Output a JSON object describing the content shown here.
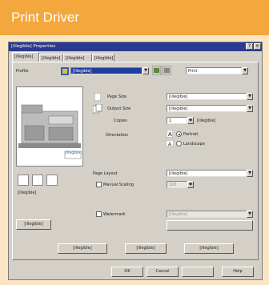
{
  "slide": {
    "title": "Print Driver"
  },
  "window": {
    "title": "[illegible] Properties",
    "buttons": {
      "help": "?",
      "close": "×"
    }
  },
  "tabs": [
    {
      "label": "[illegible]"
    },
    {
      "label": "[illegible]"
    },
    {
      "label": "[illegible]"
    },
    {
      "label": "[illegible]"
    }
  ],
  "profile": {
    "label": "Profile",
    "value": "[illegible]",
    "output_value": "Print"
  },
  "settings": {
    "page_size_label": "Page Size",
    "page_size_value": "[illegible]",
    "output_size_label": "Output Size",
    "output_size_value": "[illegible]",
    "copies_label": "Copies",
    "copies_value": "1",
    "copies_range": "[illegible]",
    "orientation_label": "Orientation",
    "portrait_label": "Portrait",
    "landscape_label": "Landscape",
    "orientation_selected": "Portrait",
    "page_layout_label": "Page Layout",
    "page_layout_value": "[illegible]",
    "manual_scaling_label": "Manual Scaling",
    "scaling_value": "100",
    "watermark_label": "Watermark",
    "watermark_value": "[illegible]"
  },
  "preview": {
    "caption": "[illegible]",
    "badge": "[illegible]"
  },
  "buttons": {
    "view_settings": "[illegible]",
    "custom_paper_size": "[illegible]",
    "page_options": "[illegible]",
    "restore_defaults": "[illegible]",
    "ok": "OK",
    "cancel": "Cancel",
    "apply": "",
    "help": "Help"
  },
  "colors": {
    "header_orange": "#f3a73c",
    "frame_cream": "#fbe6c4",
    "titlebar_blue": "#2b3a8e",
    "dialog_gray": "#d4d0c8"
  }
}
